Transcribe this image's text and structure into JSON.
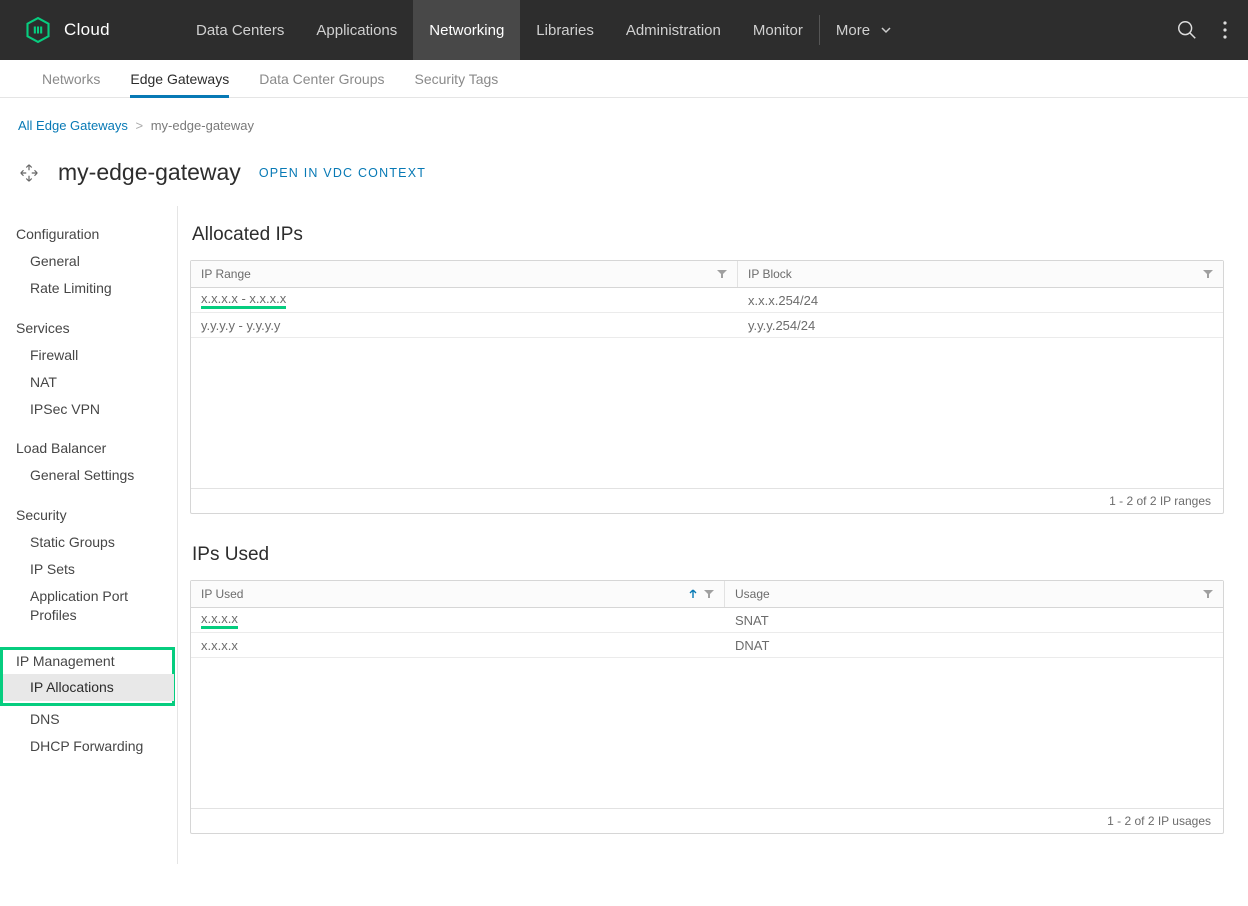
{
  "brand": "Cloud",
  "mainnav": {
    "items": [
      "Data Centers",
      "Applications",
      "Networking",
      "Libraries",
      "Administration",
      "Monitor"
    ],
    "more_label": "More",
    "active": "Networking"
  },
  "subnav": {
    "items": [
      "Networks",
      "Edge Gateways",
      "Data Center Groups",
      "Security Tags"
    ],
    "active": "Edge Gateways"
  },
  "breadcrumb": {
    "root": "All Edge Gateways",
    "current": "my-edge-gateway"
  },
  "page": {
    "title": "my-edge-gateway",
    "open_context": "OPEN IN VDC CONTEXT"
  },
  "sidebar": {
    "configuration": {
      "label": "Configuration",
      "items": [
        "General",
        "Rate Limiting"
      ]
    },
    "services": {
      "label": "Services",
      "items": [
        "Firewall",
        "NAT",
        "IPSec VPN"
      ]
    },
    "load_balancer": {
      "label": "Load Balancer",
      "items": [
        "General Settings"
      ]
    },
    "security": {
      "label": "Security",
      "items": [
        "Static Groups",
        "IP Sets",
        "Application Port Profiles"
      ]
    },
    "ip_management": {
      "label": "IP Management",
      "items": [
        "IP Allocations",
        "DNS",
        "DHCP Forwarding"
      ],
      "selected": "IP Allocations"
    }
  },
  "allocated_ips": {
    "title": "Allocated IPs",
    "cols": {
      "ip_range": "IP Range",
      "ip_block": "IP Block"
    },
    "rows": [
      {
        "ip_range": "x.x.x.x - x.x.x.x",
        "ip_block": "x.x.x.254/24",
        "highlight": true
      },
      {
        "ip_range": "y.y.y.y - y.y.y.y",
        "ip_block": "y.y.y.254/24",
        "highlight": false
      }
    ],
    "footer": "1 - 2 of 2 IP ranges"
  },
  "ips_used": {
    "title": "IPs Used",
    "cols": {
      "ip_used": "IP Used",
      "usage": "Usage"
    },
    "rows": [
      {
        "ip_used": "x.x.x.x",
        "usage": "SNAT",
        "highlight": true
      },
      {
        "ip_used": "x.x.x.x",
        "usage": "DNAT",
        "highlight": false
      }
    ],
    "footer": "1 - 2 of 2 IP usages"
  }
}
